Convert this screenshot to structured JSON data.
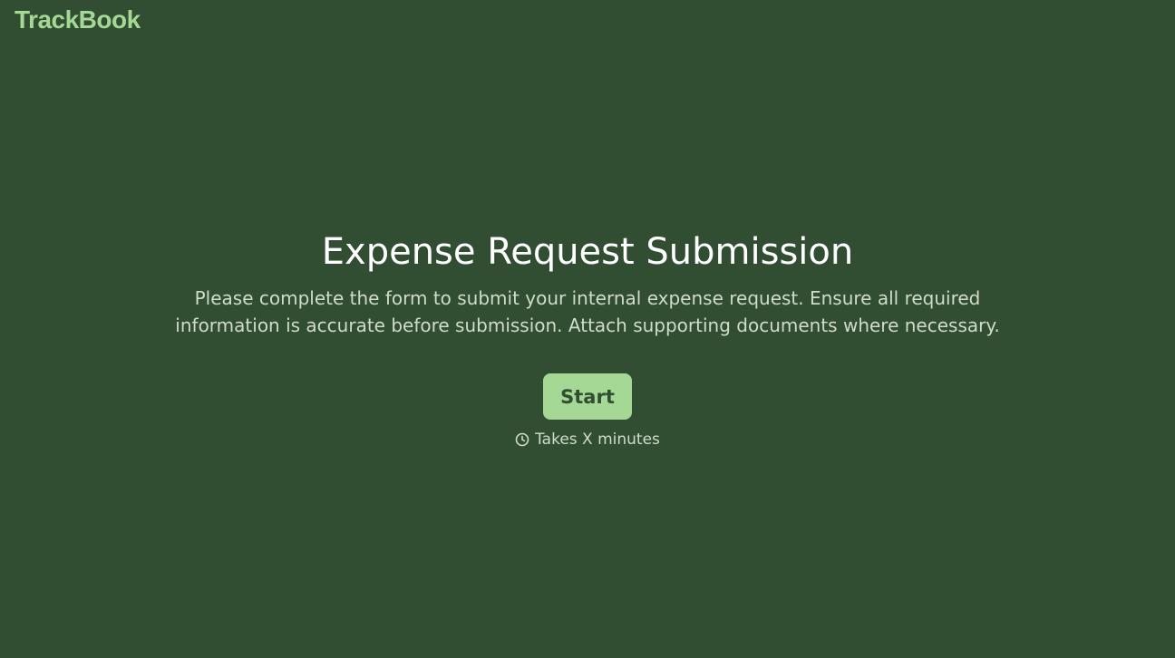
{
  "brand": {
    "name": "TrackBook"
  },
  "main": {
    "title": "Expense Request Submission",
    "description": "Please complete the form to submit your internal expense request. Ensure all required information is accurate before submission. Attach supporting documents where necessary.",
    "start_label": "Start",
    "duration_text": "Takes X minutes",
    "duration_icon": "clock-icon"
  },
  "colors": {
    "background": "#314d32",
    "accent": "#a6d895",
    "text": "#ffffff",
    "muted_text": "#d0dccb"
  }
}
